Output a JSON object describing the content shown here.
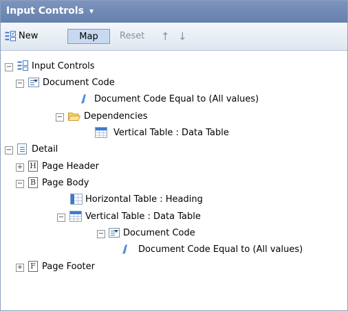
{
  "panel": {
    "title": "Input Controls",
    "caret": "▾"
  },
  "toolbar": {
    "new_label": "New",
    "map_label": "Map",
    "reset_label": "Reset",
    "up_glyph": "↑",
    "down_glyph": "↓"
  },
  "tree": {
    "input_controls": "Input Controls",
    "doc_code": "Document Code",
    "doc_code_filter": "Document Code Equal to (All values)",
    "dependencies": "Dependencies",
    "vertical_table": "Vertical Table : Data Table",
    "detail": "Detail",
    "page_header": "Page Header",
    "page_header_letter": "H",
    "page_body": "Page Body",
    "page_body_letter": "B",
    "horizontal_table": "Horizontal Table : Heading",
    "vertical_table_2": "Vertical Table : Data Table",
    "doc_code_2": "Document Code",
    "doc_code_filter_2": "Document Code Equal to (All values)",
    "page_footer": "Page Footer",
    "page_footer_letter": "F",
    "collapse": "−",
    "expand": "+"
  },
  "colors": {
    "titlebar": "#7088b3",
    "toolbar": "#e8edf4",
    "selected_button": "#c7d9f0"
  }
}
